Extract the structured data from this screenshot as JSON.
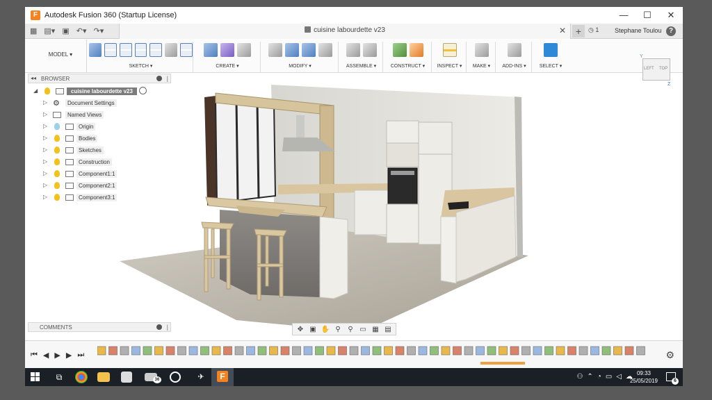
{
  "window": {
    "title": "Autodesk Fusion 360 (Startup License)",
    "app_icon_letter": "F",
    "minimize": "—",
    "maximize": "☐",
    "close": "✕"
  },
  "tabbar": {
    "document_title": "cuisine labourdette v23",
    "close_glyph": "✕",
    "new_tab_glyph": "+",
    "jobs_count": "1",
    "user": "Stephane Toulou",
    "help_glyph": "?"
  },
  "toolbar": {
    "workspace": "MODEL ▾",
    "groups": [
      {
        "label": "SKETCH ▾"
      },
      {
        "label": "CREATE ▾"
      },
      {
        "label": "MODIFY ▾"
      },
      {
        "label": "ASSEMBLE ▾"
      },
      {
        "label": "CONSTRUCT ▾"
      },
      {
        "label": "INSPECT ▾"
      },
      {
        "label": "MAKE ▾"
      },
      {
        "label": "ADD-INS ▾"
      },
      {
        "label": "SELECT ▾"
      }
    ]
  },
  "viewcube": {
    "left": "LEFT",
    "top": "TOP",
    "y": "Y",
    "z": "Z"
  },
  "browser": {
    "title": "BROWSER",
    "root": "cuisine labourdette v23",
    "items": [
      {
        "label": "Document Settings"
      },
      {
        "label": "Named Views"
      },
      {
        "label": "Origin"
      },
      {
        "label": "Bodies"
      },
      {
        "label": "Sketches"
      },
      {
        "label": "Construction"
      },
      {
        "label": "Component1:1"
      },
      {
        "label": "Component2:1"
      },
      {
        "label": "Component3:1"
      }
    ]
  },
  "comments": {
    "title": "COMMENTS"
  },
  "taskbar": {
    "fusion_letter": "F",
    "mail_badge": "36",
    "time": "09:33",
    "date": "25/05/2019",
    "notifications": "6"
  }
}
